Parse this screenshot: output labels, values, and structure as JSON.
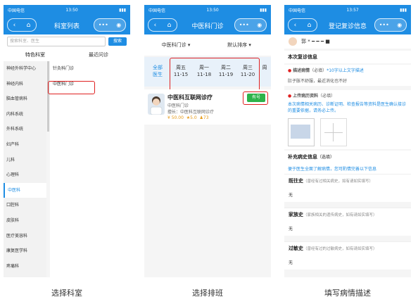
{
  "status": {
    "carrier": "中国电信",
    "time1": "13:50",
    "time3": "13:57"
  },
  "screen1": {
    "title": "科室列表",
    "search_placeholder": "搜索科室、医生",
    "search_btn": "搜索",
    "tab1": "特色科室",
    "tab2": "最近问诊",
    "depts": [
      "神经外科学中心",
      "神经内科",
      "脑血管病科",
      "内科系统",
      "外科系统",
      "妇产科",
      "儿科",
      "心理科",
      "中医科",
      "口腔科",
      "皮肤科",
      "医疗美容科",
      "康复医学科",
      "疼痛科"
    ],
    "selected_index": 8,
    "sub": [
      "针灸科门诊",
      "中医科门诊"
    ],
    "caption": "选择科室"
  },
  "screen2": {
    "title": "中医科门诊",
    "filter1": "中医科门诊 ▾",
    "filter2": "默认排序 ▾",
    "all_line1": "全部",
    "all_line2": "医生",
    "dates": [
      {
        "w": "周五",
        "d": "11-15"
      },
      {
        "w": "周一",
        "d": "11-18"
      },
      {
        "w": "周二",
        "d": "11-19"
      },
      {
        "w": "周三",
        "d": "11-20"
      },
      {
        "w": "周",
        "d": ""
      }
    ],
    "doc_name": "中医科互联网诊疗",
    "doc_dept": "中医科门诊",
    "doc_desc": "擅长：中医科互联网诊疗",
    "doc_price": "¥ 50.00",
    "doc_score": "5.0",
    "doc_count": "73",
    "badge": "有号",
    "caption": "选择排班"
  },
  "screen3": {
    "title": "登记复诊信息",
    "user": "郭 * ━ ━ ━ ■",
    "s1": "本次复诊信息",
    "desc_label": "描述病情",
    "desc_req": "（必填）",
    "desc_hint": "*10字以上文字描述",
    "desc_text": "肚子胀不舒服，最近消化也不好",
    "upload_label": "上传病历资料",
    "upload_req": "（必填）",
    "upload_hint": "本次病情相关病历、诊断证明、检查报告等资料是医生确认接诊的重要依据，请务必上传。",
    "s2": "补充病史信息",
    "s2_sub": "（选填）",
    "s2_hint": "便于医生全面了解病情，您可酌情完善以下信息",
    "hist": [
      {
        "t": "既往史",
        "h": "（曾经有过相关病史，如有请如实填写）",
        "v": "无"
      },
      {
        "t": "家族史",
        "h": "（家族相关的遗传病史，如有请如实填写）",
        "v": "无"
      },
      {
        "t": "过敏史",
        "h": "（曾经有过的过敏病史，如有请如实填写）",
        "v": "无"
      }
    ],
    "caption": "填写病情描述"
  }
}
